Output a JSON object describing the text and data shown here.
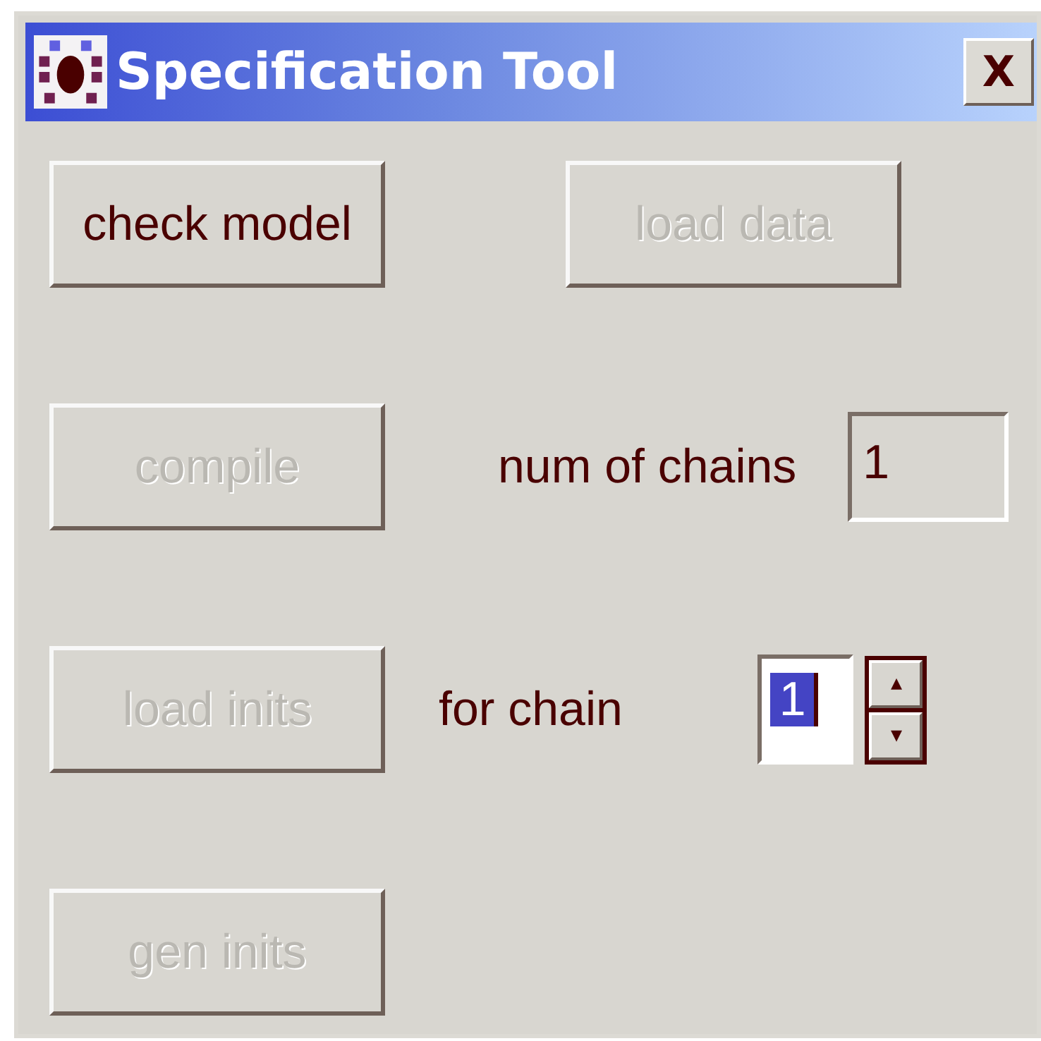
{
  "window": {
    "title": "Specification Tool",
    "close": "X"
  },
  "buttons": [
    {
      "label": "check model",
      "disabled": false
    },
    {
      "label": "load data",
      "disabled": true
    },
    {
      "label": "compile",
      "disabled": true
    },
    {
      "label": "load inits",
      "disabled": true
    },
    {
      "label": "gen inits",
      "disabled": true
    }
  ],
  "num_of_chains": {
    "label": "num of chains",
    "value": "1",
    "disabled": true
  },
  "for_chain": {
    "label": "for chain",
    "value": "1",
    "selected": true,
    "spin_up": "▴",
    "spin_down": "▾"
  }
}
